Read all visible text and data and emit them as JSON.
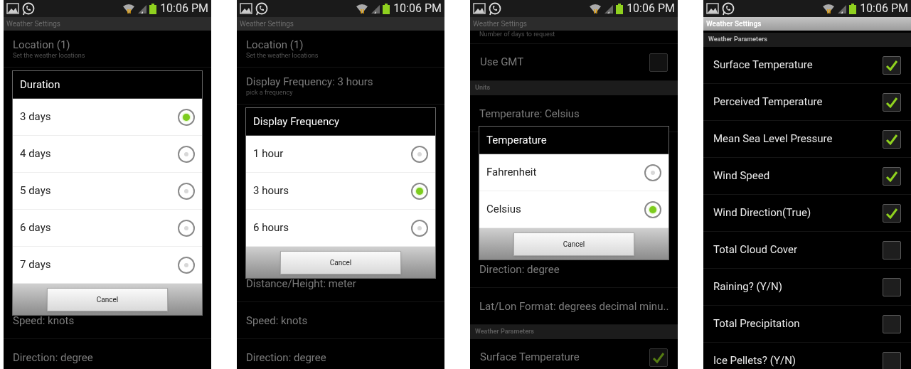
{
  "phones": [
    {
      "status_time": "10:06 PM",
      "title": "Weather Settings",
      "background_top": [
        {
          "kind": "pref",
          "title": "Location (1)",
          "subtitle": "Set the weather locations"
        }
      ],
      "background_bottom": [
        {
          "kind": "pref",
          "title": "Speed: knots"
        },
        {
          "kind": "pref",
          "title": "Direction: degree"
        }
      ],
      "dialog": {
        "title": "Duration",
        "options": [
          {
            "label": "3 days",
            "selected": true
          },
          {
            "label": "4 days",
            "selected": false
          },
          {
            "label": "5 days",
            "selected": false
          },
          {
            "label": "6 days",
            "selected": false
          },
          {
            "label": "7 days",
            "selected": false
          }
        ],
        "button": "Cancel"
      }
    },
    {
      "status_time": "10:06 PM",
      "title": "Weather Settings",
      "background_top": [
        {
          "kind": "pref",
          "title": "Location (1)",
          "subtitle": "Set the weather locations"
        },
        {
          "kind": "pref",
          "title": "Display Frequency: 3 hours",
          "subtitle": "pick a frequency"
        }
      ],
      "background_bottom": [
        {
          "kind": "pref",
          "title": "Distance/Height: meter"
        },
        {
          "kind": "pref",
          "title": "Speed: knots"
        },
        {
          "kind": "pref",
          "title": "Direction: degree"
        }
      ],
      "dialog": {
        "title": "Display Frequency",
        "options": [
          {
            "label": "1 hour",
            "selected": false
          },
          {
            "label": "3 hours",
            "selected": true
          },
          {
            "label": "6 hours",
            "selected": false
          }
        ],
        "button": "Cancel"
      }
    },
    {
      "status_time": "10:06 PM",
      "title": "Weather Settings",
      "background_top": [
        {
          "kind": "cut",
          "subtitle": "Number of days to request"
        },
        {
          "kind": "check",
          "label": "Use GMT",
          "checked": false
        },
        {
          "kind": "header",
          "label": "Units"
        },
        {
          "kind": "pref",
          "title": "Temperature: Celsius"
        }
      ],
      "background_bottom": [
        {
          "kind": "pref",
          "title": "Direction: degree"
        },
        {
          "kind": "pref",
          "title": "Lat/Lon Format: degrees decimal minu.."
        },
        {
          "kind": "header",
          "label": "Weather Parameters"
        },
        {
          "kind": "check",
          "label": "Surface Temperature",
          "checked": true
        }
      ],
      "dialog": {
        "title": "Temperature",
        "options": [
          {
            "label": "Fahrenheit",
            "selected": false
          },
          {
            "label": "Celsius",
            "selected": true
          }
        ],
        "button": "Cancel"
      }
    },
    {
      "status_time": "10:06 PM",
      "title": "Weather Settings",
      "background_top": [
        {
          "kind": "gap"
        },
        {
          "kind": "header",
          "label": "Weather Parameters"
        },
        {
          "kind": "check",
          "label": "Surface Temperature",
          "checked": true
        },
        {
          "kind": "check",
          "label": "Perceived Temperature",
          "checked": true
        },
        {
          "kind": "check",
          "label": "Mean Sea Level Pressure",
          "checked": true
        },
        {
          "kind": "check",
          "label": "Wind Speed",
          "checked": true
        },
        {
          "kind": "check",
          "label": "Wind Direction(True)",
          "checked": true
        },
        {
          "kind": "check",
          "label": "Total Cloud Cover",
          "checked": false
        },
        {
          "kind": "check",
          "label": "Raining? (Y/N)",
          "checked": false
        },
        {
          "kind": "check",
          "label": "Total Precipitation",
          "checked": false
        },
        {
          "kind": "check",
          "label": "Ice Pellets? (Y/N)",
          "checked": false
        }
      ]
    }
  ]
}
